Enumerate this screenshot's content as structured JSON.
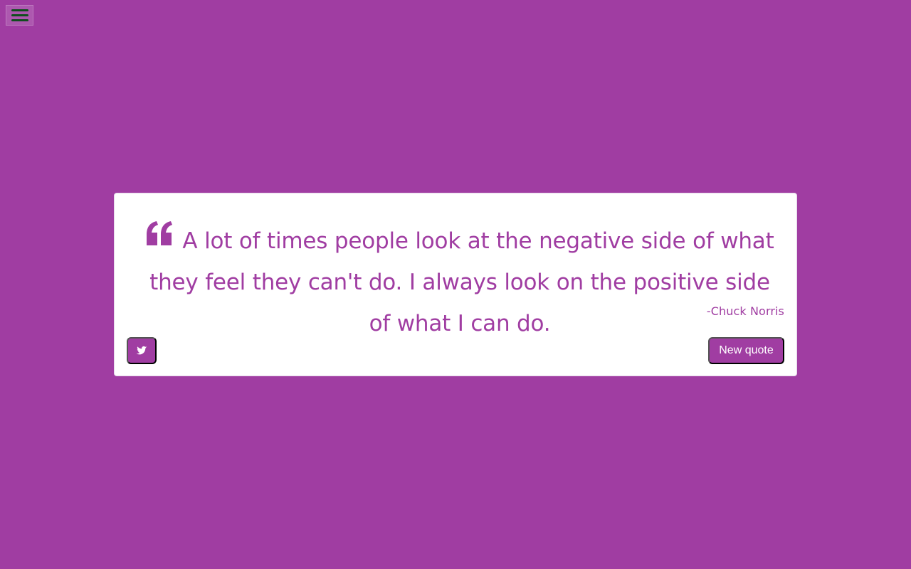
{
  "menu": {
    "icon": "menu-icon"
  },
  "quote": {
    "text": "A lot of times people look at the negative side of what they feel they can't do. I always look on the positive side of what I can do.",
    "author": "-Chuck Norris",
    "quote_icon": "quote-left-icon"
  },
  "actions": {
    "tweet_icon": "twitter-icon",
    "new_quote_label": "New quote"
  },
  "colors": {
    "background": "#a03da2",
    "card_background": "#ffffff",
    "accent": "#a03da2",
    "menu_icon_color": "#0f4d1e"
  }
}
